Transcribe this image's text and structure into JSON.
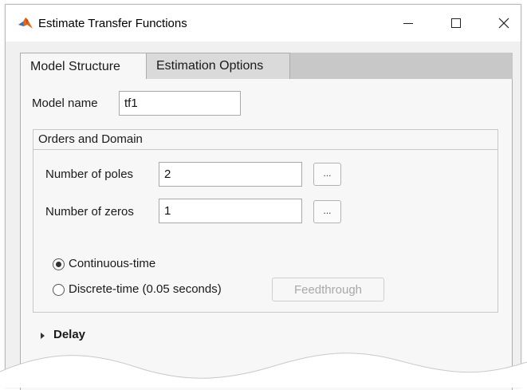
{
  "window": {
    "title": "Estimate Transfer Functions",
    "icon": "matlab-logo-icon",
    "controls": [
      "minimize-icon",
      "maximize-icon",
      "close-icon"
    ]
  },
  "tabs": [
    {
      "label": "Model Structure",
      "selected": true
    },
    {
      "label": "Estimation Options",
      "selected": false
    }
  ],
  "model": {
    "name_label": "Model name",
    "name_value": "tf1"
  },
  "orders": {
    "title": "Orders and Domain",
    "poles_label": "Number of poles",
    "poles_value": "2",
    "poles_button": "...",
    "zeros_label": "Number of zeros",
    "zeros_value": "1",
    "zeros_button": "..."
  },
  "domain": {
    "continuous_label": "Continuous-time",
    "continuous_selected": true,
    "discrete_label": "Discrete-time (0.05 seconds)",
    "discrete_selected": false,
    "feedthrough_label": "Feedthrough",
    "feedthrough_enabled": false
  },
  "delay": {
    "label": "Delay",
    "expanded": false
  }
}
